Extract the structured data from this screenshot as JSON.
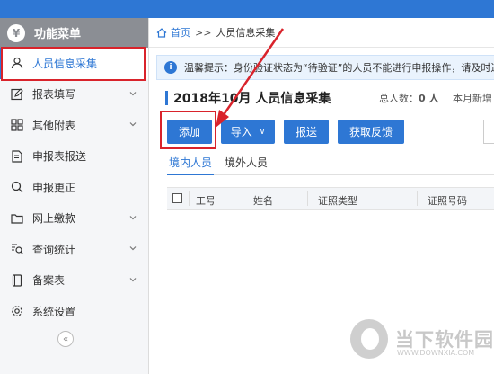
{
  "sidebar": {
    "header": "功能菜单",
    "header_icon": "yen-icon",
    "collapse_icon": "«",
    "items": [
      {
        "label": "人员信息采集",
        "icon": "user-icon",
        "expandable": false,
        "active": true
      },
      {
        "label": "报表填写",
        "icon": "edit-icon",
        "expandable": true
      },
      {
        "label": "其他附表",
        "icon": "grid-icon",
        "expandable": true
      },
      {
        "label": "申报表报送",
        "icon": "send-doc-icon",
        "expandable": false
      },
      {
        "label": "申报更正",
        "icon": "search-icon",
        "expandable": false
      },
      {
        "label": "网上缴款",
        "icon": "folder-icon",
        "expandable": true
      },
      {
        "label": "查询统计",
        "icon": "stats-search-icon",
        "expandable": true
      },
      {
        "label": "备案表",
        "icon": "file-icon",
        "expandable": true
      },
      {
        "label": "系统设置",
        "icon": "gear-icon",
        "expandable": false
      }
    ]
  },
  "breadcrumb": {
    "home": "首页",
    "separator": ">>",
    "current": "人员信息采集"
  },
  "notice": {
    "text": "温馨提示：身份验证状态为“待验证”的人员不能进行申报操作，请及时进行"
  },
  "page": {
    "title": "2018年10月  人员信息采集",
    "total_label": "总人数：",
    "total_value": "0 人",
    "new_label": "本月新增"
  },
  "toolbar": {
    "add": "添加",
    "import": "导入",
    "import_caret": "∨",
    "report": "报送",
    "feedback": "获取反馈"
  },
  "tabs": [
    "境内人员",
    "境外人员"
  ],
  "table": {
    "columns": [
      "工号",
      "姓名",
      "证照类型",
      "证照号码"
    ]
  },
  "watermark": {
    "text": "当下软件园",
    "url": "WWW.DOWNXIA.COM"
  },
  "colors": {
    "accent": "#2e77d4",
    "highlight": "#d9232b",
    "sidebar_header": "#8b8e94"
  }
}
